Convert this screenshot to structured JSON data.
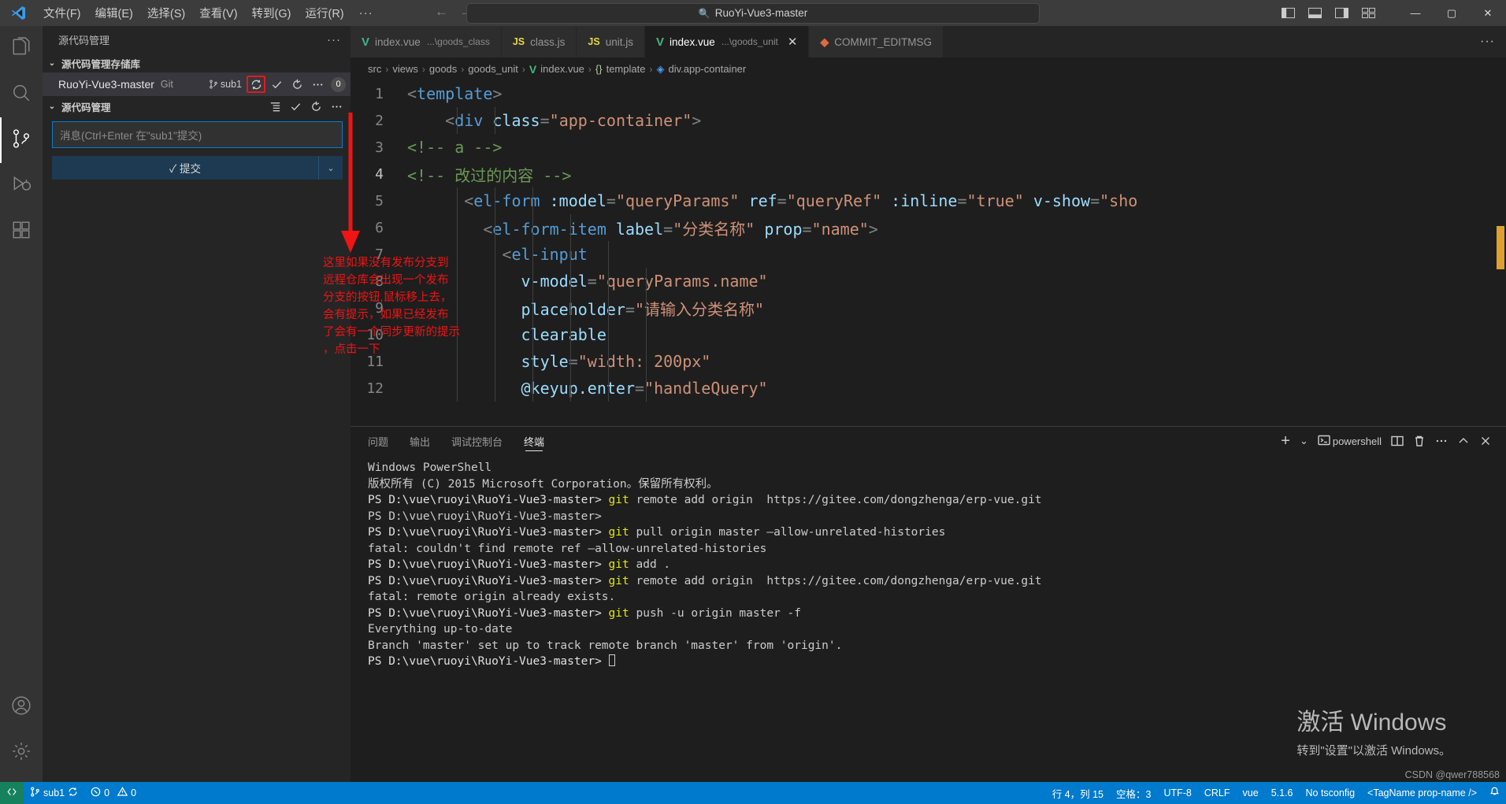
{
  "titlebar": {
    "menus": [
      "文件(F)",
      "编辑(E)",
      "选择(S)",
      "查看(V)",
      "转到(G)",
      "运行(R)"
    ],
    "more": "···",
    "search_text": "RuoYi-Vue3-master",
    "search_icon": "search-icon",
    "back_arrow": "←",
    "forward_arrow": "→",
    "minimize": "—",
    "maximize": "▢",
    "close": "✕"
  },
  "activitybar": {
    "items": [
      {
        "name": "explorer",
        "icon": "files-icon"
      },
      {
        "name": "search",
        "icon": "search-icon"
      },
      {
        "name": "source-control",
        "icon": "source-control-icon",
        "active": true
      },
      {
        "name": "run-debug",
        "icon": "run-debug-icon"
      },
      {
        "name": "extensions",
        "icon": "extensions-icon"
      }
    ],
    "bottom": [
      {
        "name": "accounts",
        "icon": "account-icon"
      },
      {
        "name": "settings",
        "icon": "gear-icon"
      }
    ]
  },
  "sidebar": {
    "title": "源代码管理",
    "more": "···",
    "repos_section": {
      "label": "源代码管理存储库",
      "chevron": "⌄",
      "repo_name": "RuoYi-Vue3-master",
      "repo_type": "Git",
      "branch": "sub1",
      "sync_icon": "sync-icon",
      "check_icon": "check-icon",
      "refresh_icon": "refresh-icon",
      "more_icon": "more-icon",
      "count": "0"
    },
    "scm_section": {
      "label": "源代码管理",
      "chevron": "⌄",
      "view_icon": "view-as-tree-icon",
      "check_icon": "check-icon",
      "refresh_icon": "refresh-icon",
      "more_icon": "more-icon"
    },
    "commit": {
      "placeholder": "消息(Ctrl+Enter 在\"sub1\"提交)",
      "button_label": "✓ 提交",
      "split_chevron": "⌄"
    }
  },
  "annotation": {
    "lines": [
      "这里如果没有发布分支到",
      "远程仓库会出现一个发布",
      "分支的按钮,鼠标移上去，",
      "会有提示，如果已经发布",
      "了会有一个同步更新的提示",
      "，点击一下"
    ],
    "color": "#f01414"
  },
  "editor": {
    "tabs": [
      {
        "icon": "vue-icon",
        "name": "index.vue",
        "path": "...\\goods_class",
        "active": false,
        "close": ""
      },
      {
        "icon": "js-icon",
        "name": "class.js",
        "path": "",
        "active": false,
        "close": ""
      },
      {
        "icon": "js-icon",
        "name": "unit.js",
        "path": "",
        "active": false,
        "close": ""
      },
      {
        "icon": "vue-icon",
        "name": "index.vue",
        "path": "...\\goods_unit",
        "active": true,
        "close": "✕"
      },
      {
        "icon": "git-icon",
        "name": "COMMIT_EDITMSG",
        "path": "",
        "active": false,
        "close": ""
      }
    ],
    "tabs_more": "···",
    "breadcrumb": [
      "src",
      "views",
      "goods",
      "goods_unit",
      "index.vue",
      "template",
      "div.app-container"
    ],
    "breadcrumb_sep": "›",
    "lines": [
      {
        "no": "1",
        "tokens": [
          {
            "t": "<",
            "c": "punc"
          },
          {
            "t": "template",
            "c": "tag"
          },
          {
            "t": ">",
            "c": "punc"
          }
        ],
        "indent": 0
      },
      {
        "no": "2",
        "tokens": [
          {
            "t": "    ",
            "c": "plain"
          },
          {
            "t": "<",
            "c": "punc"
          },
          {
            "t": "div",
            "c": "tag"
          },
          {
            "t": " ",
            "c": "plain"
          },
          {
            "t": "class",
            "c": "attr"
          },
          {
            "t": "=",
            "c": "punc"
          },
          {
            "t": "\"app-container\"",
            "c": "str"
          },
          {
            "t": ">",
            "c": "punc"
          }
        ],
        "indent": 2
      },
      {
        "no": "3",
        "tokens": [
          {
            "t": "<!-- a -->",
            "c": "cmt"
          }
        ],
        "indent": 0
      },
      {
        "no": "4",
        "tokens": [
          {
            "t": "<!-- 改过的内容 -->",
            "c": "cmt"
          }
        ],
        "indent": 0
      },
      {
        "no": "5",
        "tokens": [
          {
            "t": "      ",
            "c": "plain"
          },
          {
            "t": "<",
            "c": "punc"
          },
          {
            "t": "el-form",
            "c": "tag"
          },
          {
            "t": " ",
            "c": "plain"
          },
          {
            "t": ":model",
            "c": "attr"
          },
          {
            "t": "=",
            "c": "punc"
          },
          {
            "t": "\"queryParams\"",
            "c": "str"
          },
          {
            "t": " ",
            "c": "plain"
          },
          {
            "t": "ref",
            "c": "attr"
          },
          {
            "t": "=",
            "c": "punc"
          },
          {
            "t": "\"queryRef\"",
            "c": "str"
          },
          {
            "t": " ",
            "c": "plain"
          },
          {
            "t": ":inline",
            "c": "attr"
          },
          {
            "t": "=",
            "c": "punc"
          },
          {
            "t": "\"true\"",
            "c": "str"
          },
          {
            "t": " ",
            "c": "plain"
          },
          {
            "t": "v-show",
            "c": "attr"
          },
          {
            "t": "=",
            "c": "punc"
          },
          {
            "t": "\"sho",
            "c": "str"
          }
        ],
        "indent": 3
      },
      {
        "no": "6",
        "tokens": [
          {
            "t": "        ",
            "c": "plain"
          },
          {
            "t": "<",
            "c": "punc"
          },
          {
            "t": "el-form-item",
            "c": "tag"
          },
          {
            "t": " ",
            "c": "plain"
          },
          {
            "t": "label",
            "c": "attr"
          },
          {
            "t": "=",
            "c": "punc"
          },
          {
            "t": "\"分类名称\"",
            "c": "str"
          },
          {
            "t": " ",
            "c": "plain"
          },
          {
            "t": "prop",
            "c": "attr"
          },
          {
            "t": "=",
            "c": "punc"
          },
          {
            "t": "\"name\"",
            "c": "str"
          },
          {
            "t": ">",
            "c": "punc"
          }
        ],
        "indent": 4
      },
      {
        "no": "7",
        "tokens": [
          {
            "t": "          ",
            "c": "plain"
          },
          {
            "t": "<",
            "c": "punc"
          },
          {
            "t": "el-input",
            "c": "tag"
          }
        ],
        "indent": 5
      },
      {
        "no": "8",
        "tokens": [
          {
            "t": "            ",
            "c": "plain"
          },
          {
            "t": "v-model",
            "c": "attr"
          },
          {
            "t": "=",
            "c": "punc"
          },
          {
            "t": "\"queryParams.name\"",
            "c": "str"
          }
        ],
        "indent": 6
      },
      {
        "no": "9",
        "tokens": [
          {
            "t": "            ",
            "c": "plain"
          },
          {
            "t": "placeholder",
            "c": "attr"
          },
          {
            "t": "=",
            "c": "punc"
          },
          {
            "t": "\"请输入分类名称\"",
            "c": "str"
          }
        ],
        "indent": 6
      },
      {
        "no": "10",
        "tokens": [
          {
            "t": "            ",
            "c": "plain"
          },
          {
            "t": "clearable",
            "c": "attr"
          }
        ],
        "indent": 6
      },
      {
        "no": "11",
        "tokens": [
          {
            "t": "            ",
            "c": "plain"
          },
          {
            "t": "style",
            "c": "attr"
          },
          {
            "t": "=",
            "c": "punc"
          },
          {
            "t": "\"width: 200px\"",
            "c": "str"
          }
        ],
        "indent": 6
      },
      {
        "no": "12",
        "tokens": [
          {
            "t": "            ",
            "c": "plain"
          },
          {
            "t": "@keyup.enter",
            "c": "attr"
          },
          {
            "t": "=",
            "c": "punc"
          },
          {
            "t": "\"handleQuery\"",
            "c": "str"
          }
        ],
        "indent": 6
      }
    ]
  },
  "panel": {
    "tabs": [
      "问题",
      "输出",
      "调试控制台",
      "终端"
    ],
    "active_tab": "终端",
    "actions": {
      "add": "+",
      "add_chevron": "⌄",
      "shell_name": "powershell",
      "shell_icon": "terminal-icon",
      "split_icon": "split-editor-icon",
      "kill_icon": "trash-icon",
      "more_icon": "more-icon",
      "chevron_up_icon": "chevron-up-icon",
      "close_icon": "close-icon"
    },
    "terminal_lines": [
      "Windows PowerShell",
      "版权所有 (C) 2015 Microsoft Corporation。保留所有权利。",
      "",
      "PS D:\\vue\\ruoyi\\RuoYi-Vue3-master> git remote add origin  https://gitee.com/dongzhenga/erp-vue.git",
      "PS D:\\vue\\ruoyi\\RuoYi-Vue3-master>",
      "PS D:\\vue\\ruoyi\\RuoYi-Vue3-master> git pull origin master –allow-unrelated-histories",
      "fatal: couldn't find remote ref –allow-unrelated-histories",
      "PS D:\\vue\\ruoyi\\RuoYi-Vue3-master> git add .",
      "PS D:\\vue\\ruoyi\\RuoYi-Vue3-master> git remote add origin  https://gitee.com/dongzhenga/erp-vue.git",
      "fatal: remote origin already exists.",
      "PS D:\\vue\\ruoyi\\RuoYi-Vue3-master> git push -u origin master -f",
      "Everything up-to-date",
      "Branch 'master' set up to track remote branch 'master' from 'origin'.",
      "PS D:\\vue\\ruoyi\\RuoYi-Vue3-master> "
    ]
  },
  "watermark": {
    "line1": "激活 Windows",
    "line2": "转到\"设置\"以激活 Windows。"
  },
  "statusbar": {
    "remote_icon": "remote-window-icon",
    "branch_icon": "branch-icon",
    "branch": "sub1",
    "sync_icon": "sync-icon",
    "errors_icon": "error-icon",
    "errors": "0",
    "warnings_icon": "warning-icon",
    "warnings": "0",
    "cursor_pos": "行 4，列 15",
    "spaces": "空格：3",
    "encoding": "UTF-8",
    "eol": "CRLF",
    "language": "vue",
    "version": "5.1.6",
    "tsconfig": "No tsconfig",
    "tag_name": "<TagName prop-name />",
    "bell_icon": "bell-icon"
  },
  "credit": "CSDN @qwer788568"
}
